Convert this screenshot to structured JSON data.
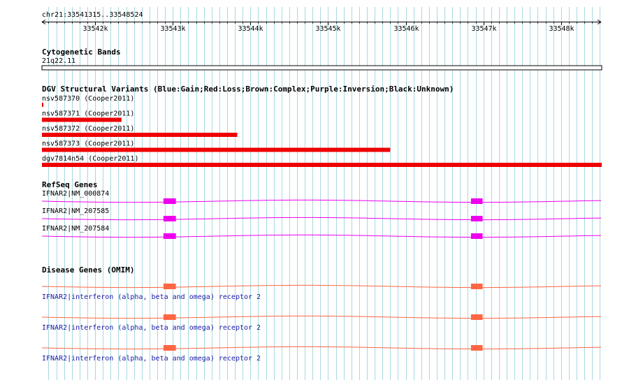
{
  "ruler": {
    "range_label": "chr21:33541315..33548524",
    "start": 33541315,
    "end": 33548524,
    "ticks": [
      {
        "pos": 33542000,
        "label": "33542k"
      },
      {
        "pos": 33543000,
        "label": "33543k"
      },
      {
        "pos": 33544000,
        "label": "33544k"
      },
      {
        "pos": 33545000,
        "label": "33545k"
      },
      {
        "pos": 33546000,
        "label": "33546k"
      },
      {
        "pos": 33547000,
        "label": "33547k"
      },
      {
        "pos": 33548000,
        "label": "33548k"
      }
    ]
  },
  "cytoband": {
    "title": "Cytogenetic Bands",
    "band": "21q22.11"
  },
  "dgv": {
    "title": "DGV Structural Variants (Blue:Gain;Red:Loss;Brown:Complex;Purple:Inversion;Black:Unknown)",
    "color": "#ee0000",
    "variants": [
      {
        "label": "nsv587370 (Cooper2011)",
        "start": 33541315,
        "end": 33541330
      },
      {
        "label": "nsv587371 (Cooper2011)",
        "start": 33541315,
        "end": 33542340
      },
      {
        "label": "nsv587372 (Cooper2011)",
        "start": 33541315,
        "end": 33543830
      },
      {
        "label": "nsv587373 (Cooper2011)",
        "start": 33541315,
        "end": 33545800
      },
      {
        "label": "dgv7814n54 (Cooper2011)",
        "start": 33541315,
        "end": 33548524
      }
    ]
  },
  "refseq": {
    "title": "RefSeq Genes",
    "color": "#ee00ee",
    "transcripts": [
      {
        "label": "IFNAR2|NM_000874",
        "exons": [
          [
            33542880,
            33543040
          ],
          [
            33546840,
            33546990
          ]
        ]
      },
      {
        "label": "IFNAR2|NM_207585",
        "exons": [
          [
            33542880,
            33543040
          ],
          [
            33546840,
            33546990
          ]
        ]
      },
      {
        "label": "IFNAR2|NM_207584",
        "exons": [
          [
            33542880,
            33543040
          ],
          [
            33546840,
            33546990
          ]
        ]
      }
    ]
  },
  "omim": {
    "title": "Disease Genes (OMIM)",
    "color": "#ff6644",
    "genes": [
      {
        "label": "IFNAR2|interferon (alpha, beta and omega) receptor 2",
        "exons": [
          [
            33542880,
            33543040
          ],
          [
            33546840,
            33546990
          ]
        ]
      },
      {
        "label": "IFNAR2|interferon (alpha, beta and omega) receptor 2",
        "exons": [
          [
            33542880,
            33543040
          ],
          [
            33546840,
            33546990
          ]
        ]
      },
      {
        "label": "IFNAR2|interferon (alpha, beta and omega) receptor 2",
        "exons": [
          [
            33542880,
            33543040
          ],
          [
            33546840,
            33546990
          ]
        ]
      }
    ]
  },
  "colors": {
    "grid": "#a8d8e0",
    "axis": "#000000",
    "label": "#1a1aa6"
  }
}
